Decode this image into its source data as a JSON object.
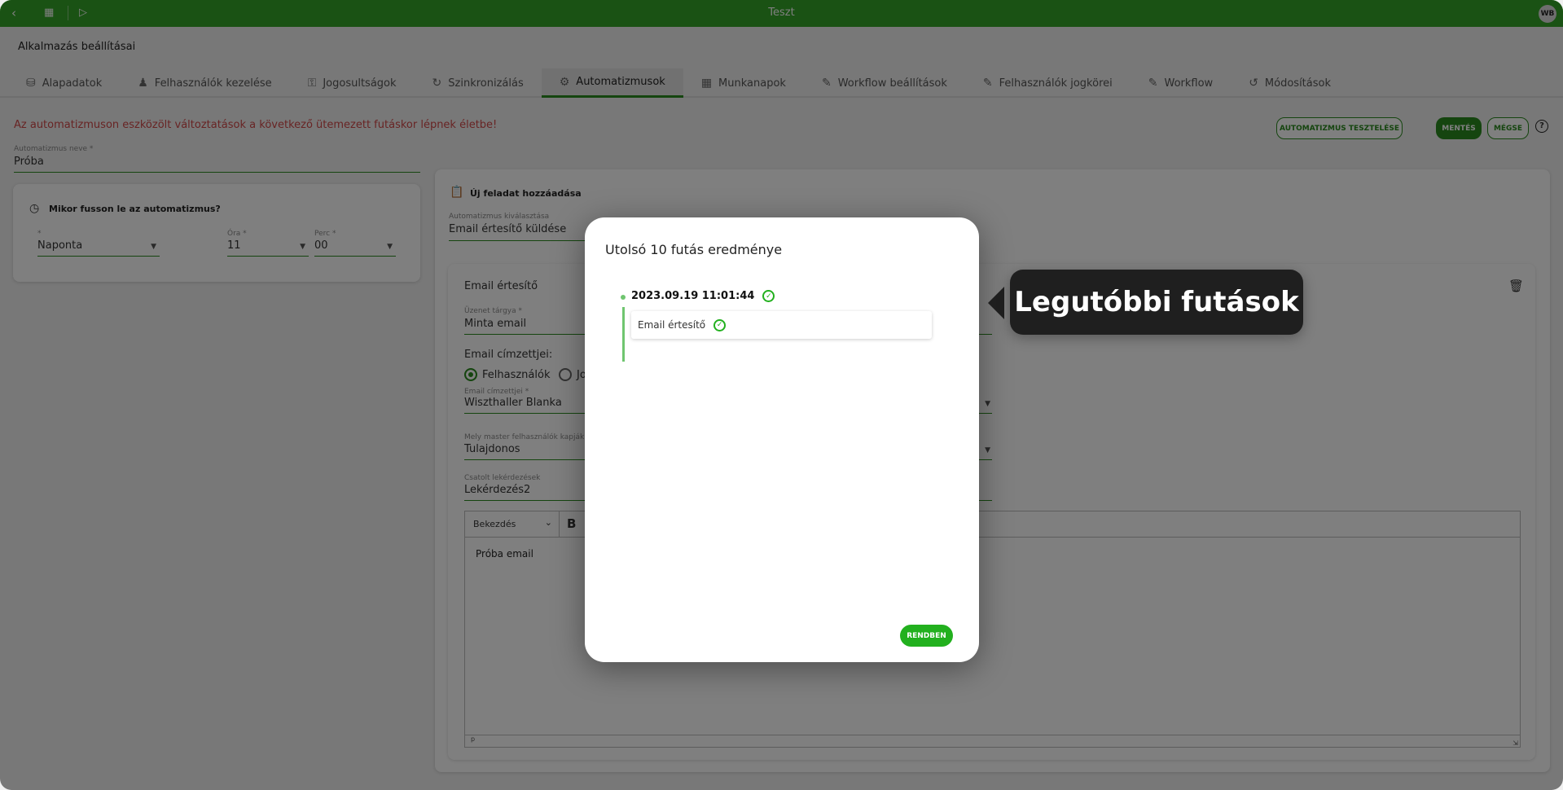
{
  "topbar": {
    "title": "Teszt",
    "avatar": "WB",
    "icons": [
      "back-icon",
      "apps-icon",
      "play-icon"
    ]
  },
  "page": {
    "title": "Alkalmazás beállításai"
  },
  "tabs": [
    {
      "label": "Alapadatok",
      "icon": "database-icon"
    },
    {
      "label": "Felhasználók kezelése",
      "icon": "user-icon"
    },
    {
      "label": "Jogosultságok",
      "icon": "key-icon"
    },
    {
      "label": "Szinkronizálás",
      "icon": "sync-icon"
    },
    {
      "label": "Automatizmusok",
      "icon": "gear-sync-icon",
      "active": true
    },
    {
      "label": "Munkanapok",
      "icon": "calendar-icon"
    },
    {
      "label": "Workflow beállítások",
      "icon": "pencil-icon"
    },
    {
      "label": "Felhasználók jogkörei",
      "icon": "pencil-icon"
    },
    {
      "label": "Workflow",
      "icon": "pencil-icon"
    },
    {
      "label": "Módosítások",
      "icon": "history-icon"
    }
  ],
  "warning": "Az automatizmuson eszközölt változtatások a következő ütemezett futáskor lépnek életbe!",
  "actions": {
    "test": "AUTOMATIZMUS TESZTELÉSE",
    "save": "MENTÉS",
    "cancel": "MÉGSE"
  },
  "form": {
    "name_label": "Automatizmus neve *",
    "name_value": "Próba",
    "schedule": {
      "title": "Mikor fusson le az automatizmus?",
      "freq_label": "*",
      "freq_value": "Naponta",
      "hour_label": "Óra *",
      "hour_value": "11",
      "minute_label": "Perc *",
      "minute_value": "00"
    },
    "task": {
      "title": "Új feladat hozzáadása",
      "select_label": "Automatizmus kiválasztása",
      "select_value": "Email értesítő küldése",
      "card_title": "Email értesítő",
      "subject_label": "Üzenet tárgya *",
      "subject_value": "Minta email",
      "recipients_title": "Email címzettjei:",
      "radio_users": "Felhasználók",
      "radio_other": "Jo",
      "recipients_label": "Email címzettjei *",
      "recipients_value": "Wiszthaller Blanka",
      "master_label": "Mely master felhasználók kapják meg",
      "master_value": "Tulajdonos",
      "queries_label": "Csatolt lekérdezések",
      "queries_value": "Lekérdezés2",
      "editor_format": "Bekezdés",
      "editor_bold": "B",
      "editor_content": "Próba email",
      "editor_status": "p"
    }
  },
  "modal": {
    "title": "Utolsó 10 futás eredménye",
    "runs": [
      {
        "datetime": "2023.09.19 11:01:44",
        "status": "success",
        "tasks": [
          {
            "name": "Email értesítő",
            "status": "success"
          }
        ]
      }
    ],
    "ok": "RENDBEN"
  },
  "tooltip": "Legutóbbi futások",
  "colors": {
    "brand": "#34a428",
    "success": "#22b01e",
    "warning": "#d04848"
  }
}
